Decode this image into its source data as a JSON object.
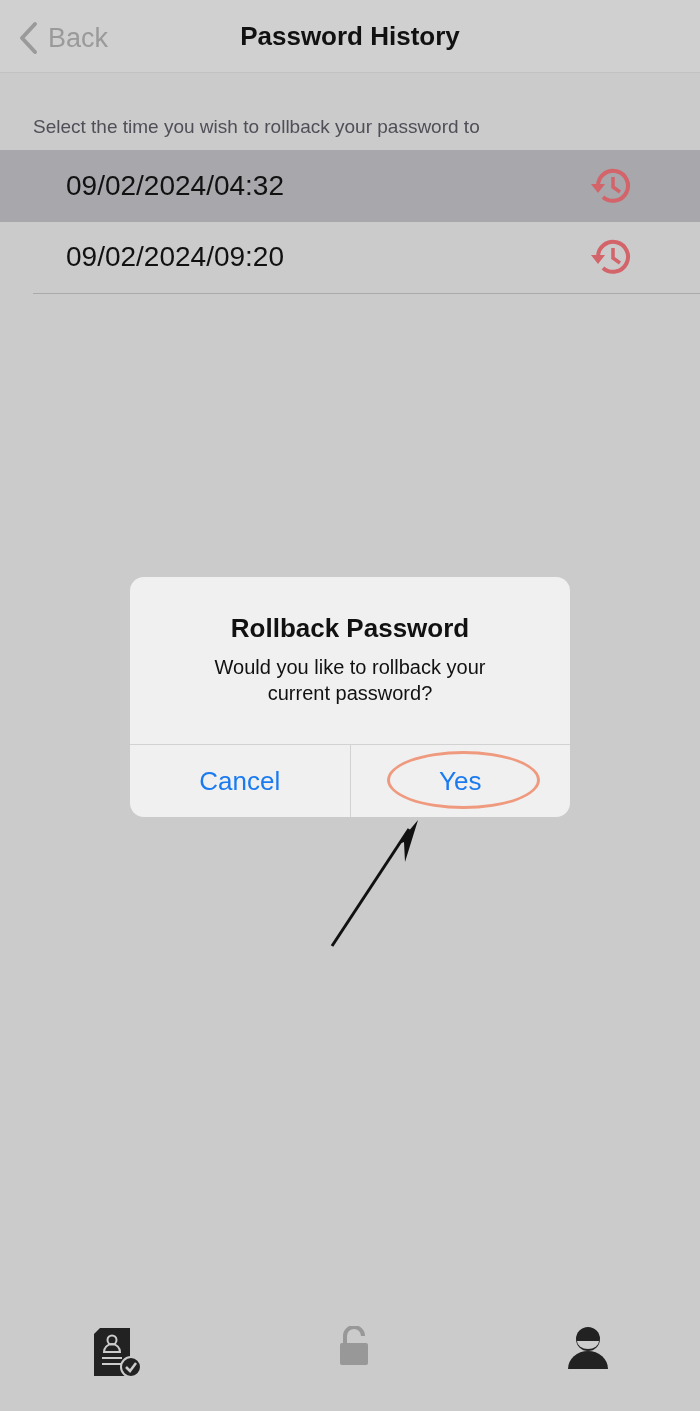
{
  "nav": {
    "back": "Back",
    "title": "Password History"
  },
  "hint": "Select the time you wish to rollback your password to",
  "history": [
    {
      "time": "09/02/2024/04:32",
      "selected": true
    },
    {
      "time": "09/02/2024/09:20",
      "selected": false
    }
  ],
  "dialog": {
    "title": "Rollback Password",
    "message": "Would you like to rollback your current password?",
    "buttons": [
      {
        "label": "Cancel",
        "highlighted": false
      },
      {
        "label": "Yes",
        "highlighted": true
      }
    ]
  },
  "tab_bar": [
    {
      "kind": "document",
      "selected": false
    },
    {
      "kind": "lock",
      "selected": true
    },
    {
      "kind": "person",
      "selected": false
    }
  ]
}
